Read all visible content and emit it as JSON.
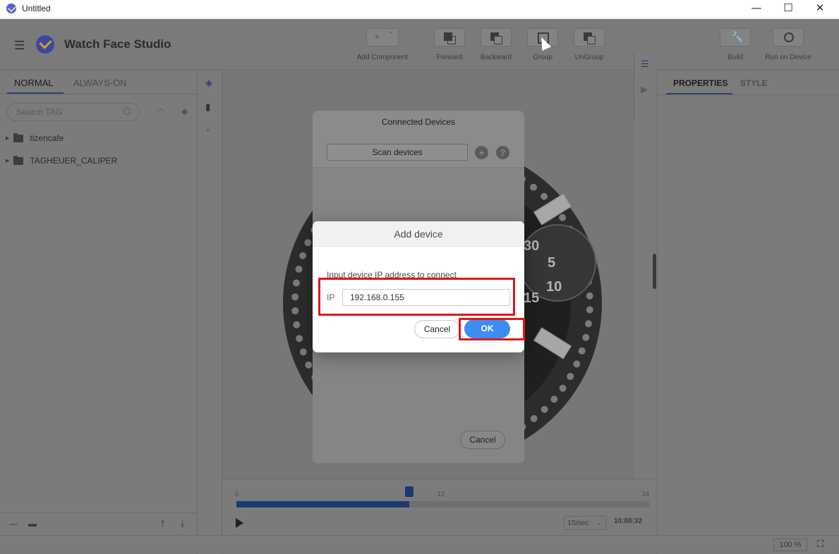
{
  "window": {
    "title": "Untitled",
    "minimize": "—",
    "maximize": "☐",
    "close": "✕"
  },
  "app": {
    "name": "Watch Face Studio",
    "menu_icon": "hamburger-icon"
  },
  "toolbar": {
    "add_component": "Add Component",
    "forward": "Forward",
    "backward": "Backward",
    "group": "Group",
    "ungroup": "UnGroup",
    "build": "Build",
    "run_on_device": "Run on Device"
  },
  "left_panel": {
    "tabs": [
      "NORMAL",
      "ALWAYS-ON"
    ],
    "search_placeholder": "Search TAG",
    "tree": [
      "tizencafe",
      "TAGHEUER_CALIPER"
    ]
  },
  "right_panel": {
    "tabs": [
      "PROPERTIES",
      "STYLE"
    ]
  },
  "timeline": {
    "marks": [
      "0",
      "12",
      "24"
    ],
    "progress_fraction": 0.42,
    "speed": "1S/sec",
    "time": "10:08:32"
  },
  "status": {
    "zoom": "100 %"
  },
  "watch": {
    "numerals": [
      "30",
      "5",
      "10",
      "15"
    ]
  },
  "connected_devices": {
    "title": "Connected Devices",
    "scan_label": "Scan devices",
    "add_icon": "plus-icon",
    "help_icon": "question-icon",
    "cancel_label": "Cancel"
  },
  "add_device": {
    "title": "Add device",
    "hint": "Input device IP address to connect",
    "ip_label": "IP",
    "ip_value": "192.168.0.155",
    "cancel_label": "Cancel",
    "ok_label": "OK"
  },
  "colors": {
    "accent": "#3d8df0",
    "highlight": "#e0161c",
    "overlay": "#7b7b7b"
  }
}
